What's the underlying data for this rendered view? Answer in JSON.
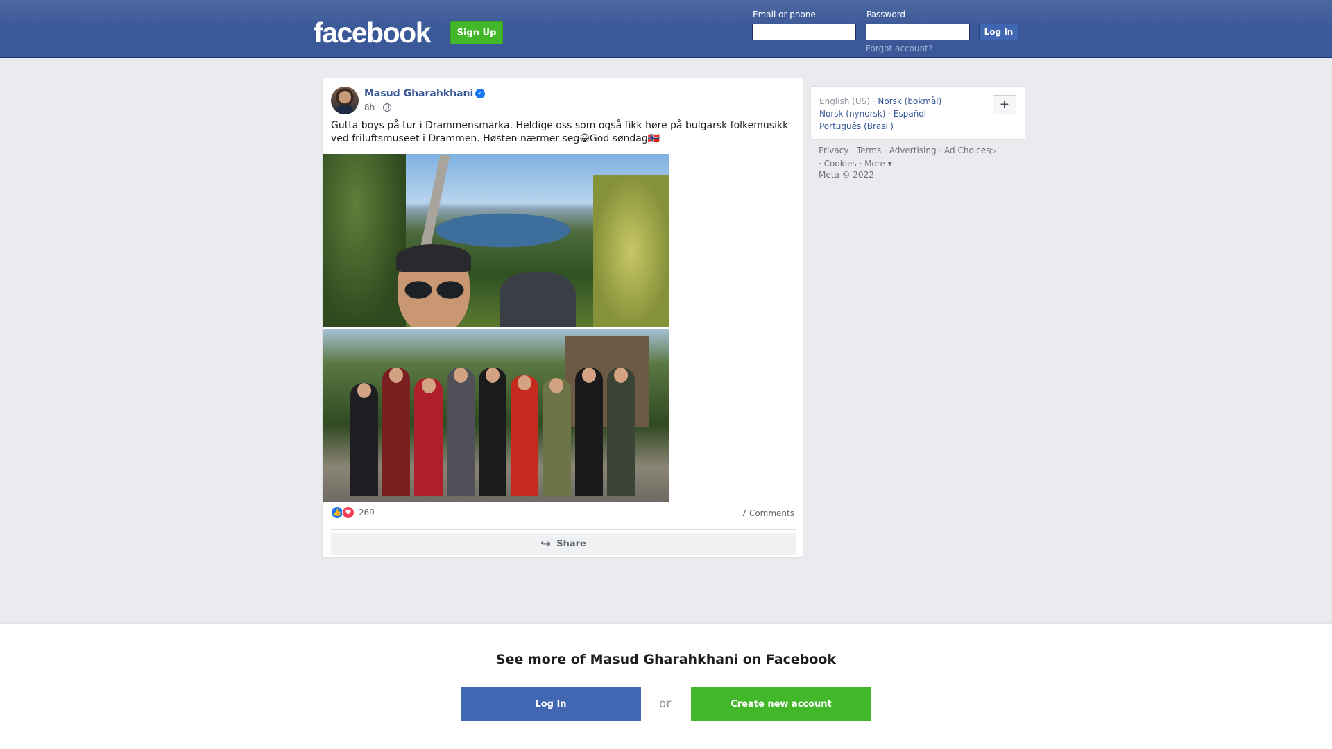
{
  "header": {
    "logo": "facebook",
    "signup_label": "Sign Up",
    "email_label": "Email or phone",
    "email_value": "",
    "password_label": "Password",
    "password_value": "",
    "login_label": "Log In",
    "forgot_label": "Forgot account?"
  },
  "post": {
    "author": "Masud Gharahkhani",
    "verified": true,
    "time": "8h ·",
    "text": "Gutta boys på tur i Drammensmarka. Heldige oss som også fikk høre på bulgarsk folkemusikk ved friluftsmuseet i Drammen. Høsten nærmer seg😀God søndag🇳🇴",
    "reaction_count": "269",
    "comments": "7 Comments",
    "share_label": "Share"
  },
  "sidebar": {
    "languages": {
      "current": "English (US)",
      "others": [
        "Norsk (bokmål)",
        "Norsk (nynorsk)",
        "Español",
        "Português (Brasil)"
      ]
    },
    "plus_label": "+",
    "footer_links": [
      "Privacy",
      "Terms",
      "Advertising",
      "Ad Choices",
      "Cookies",
      "More"
    ],
    "copyright": "Meta © 2022"
  },
  "overlay": {
    "title": "See more of Masud Gharahkhani on Facebook",
    "login_label": "Log In",
    "or_label": "or",
    "create_label": "Create new account"
  },
  "colors": {
    "header_bg": "#3b5998",
    "link": "#385898",
    "login_button": "#4267b2",
    "green_button": "#42b72a"
  }
}
